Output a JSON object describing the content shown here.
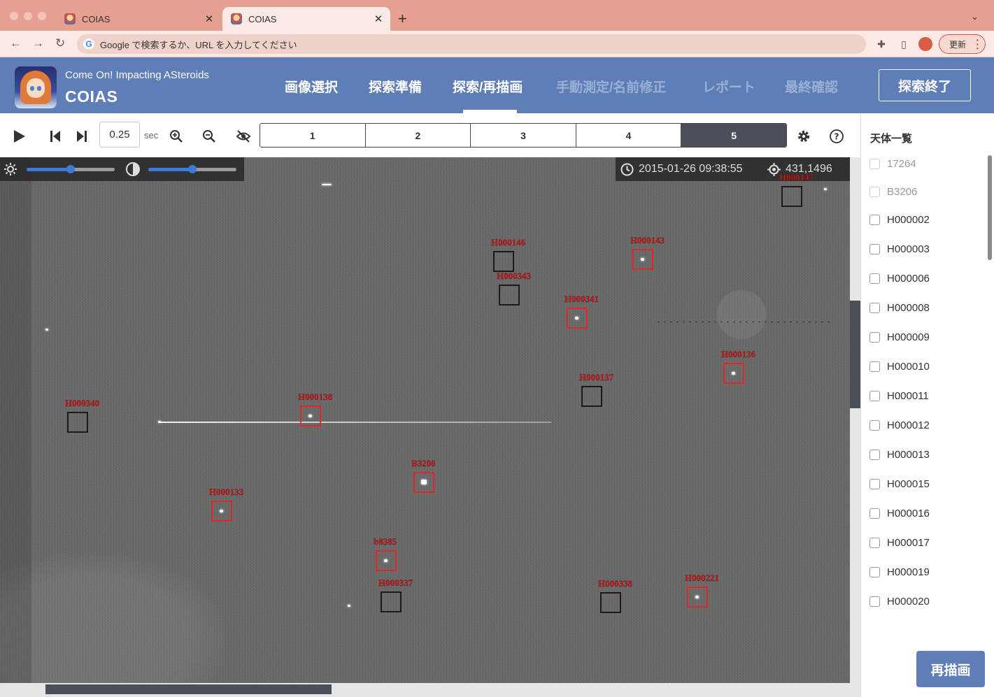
{
  "browser": {
    "tabs": [
      {
        "title": "COIAS",
        "active": false
      },
      {
        "title": "COIAS",
        "active": true
      }
    ],
    "address_placeholder": "Google で検索するか、URL を入力してください",
    "update_label": "更新"
  },
  "header": {
    "tagline": "Come On! Impacting ASteroids",
    "app_name": "COIAS",
    "menu": [
      {
        "label": "画像選択",
        "state": "normal"
      },
      {
        "label": "探索準備",
        "state": "normal"
      },
      {
        "label": "探索/再描画",
        "state": "active"
      },
      {
        "label": "手動測定/名前修正",
        "state": "disabled"
      },
      {
        "label": "レポート",
        "state": "disabled"
      },
      {
        "label": "最終確認",
        "state": "disabled"
      }
    ],
    "end_button": "探索終了"
  },
  "controls": {
    "interval_value": "0.25",
    "interval_unit": "sec",
    "frames": [
      "1",
      "2",
      "3",
      "4",
      "5"
    ],
    "active_frame": "5"
  },
  "image": {
    "timestamp": "2015-01-26 09:38:55",
    "cursor_coords": "431,1496",
    "brightness_level": 0.5,
    "contrast_level": 0.5,
    "markers": [
      {
        "label": "H000147",
        "color": "black"
      },
      {
        "label": "H000146",
        "color": "black"
      },
      {
        "label": "H000143",
        "color": "red"
      },
      {
        "label": "H000343",
        "color": "black"
      },
      {
        "label": "H000341",
        "color": "red"
      },
      {
        "label": "H000136",
        "color": "red"
      },
      {
        "label": "H000137",
        "color": "black"
      },
      {
        "label": "H000138",
        "color": "red"
      },
      {
        "label": "H000340",
        "color": "black"
      },
      {
        "label": "B3206",
        "color": "red"
      },
      {
        "label": "H000133",
        "color": "red"
      },
      {
        "label": "b8385",
        "color": "red"
      },
      {
        "label": "H000337",
        "color": "black"
      },
      {
        "label": "H000338",
        "color": "black"
      },
      {
        "label": "H000221",
        "color": "red"
      }
    ]
  },
  "panel": {
    "title": "天体一覧",
    "objects": [
      {
        "name": "17264",
        "disabled": true
      },
      {
        "name": "B3206",
        "disabled": true
      },
      {
        "name": "H000002",
        "disabled": false
      },
      {
        "name": "H000003",
        "disabled": false
      },
      {
        "name": "H000006",
        "disabled": false
      },
      {
        "name": "H000008",
        "disabled": false
      },
      {
        "name": "H000009",
        "disabled": false
      },
      {
        "name": "H000010",
        "disabled": false
      },
      {
        "name": "H000011",
        "disabled": false
      },
      {
        "name": "H000012",
        "disabled": false
      },
      {
        "name": "H000013",
        "disabled": false
      },
      {
        "name": "H000015",
        "disabled": false
      },
      {
        "name": "H000016",
        "disabled": false
      },
      {
        "name": "H000017",
        "disabled": false
      },
      {
        "name": "H000019",
        "disabled": false
      },
      {
        "name": "H000020",
        "disabled": false
      }
    ],
    "redraw_button": "再描画"
  },
  "colors": {
    "accent": "#5f7db7",
    "marker_red": "#e0262b",
    "frame_active": "#4a4f59",
    "chrome": "#e6a091"
  }
}
